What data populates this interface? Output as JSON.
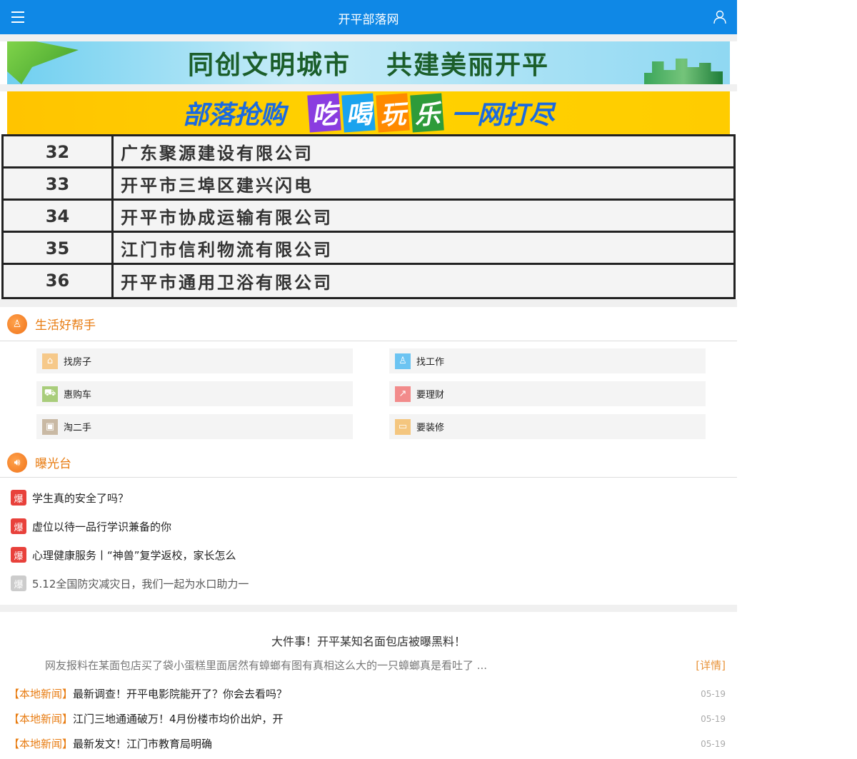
{
  "header": {
    "title": "开平部落网",
    "menu_icon": "menu-icon",
    "user_icon": "user-icon"
  },
  "banners": [
    {
      "text_a": "同创文明城市",
      "text_b": "共建美丽开平"
    },
    {
      "text_a": "部落抢购",
      "tags": [
        "吃",
        "喝",
        "玩",
        "乐"
      ],
      "text_b": "一网打尽"
    }
  ],
  "notice_table": [
    {
      "no": "32",
      "name": "广东聚源建设有限公司"
    },
    {
      "no": "33",
      "name": "开平市三埠区建兴闪电"
    },
    {
      "no": "34",
      "name": "开平市协成运输有限公司"
    },
    {
      "no": "35",
      "name": "江门市信利物流有限公司"
    },
    {
      "no": "36",
      "name": "开平市通用卫浴有限公司"
    }
  ],
  "helper": {
    "title": "生活好帮手",
    "items": [
      {
        "label": "找房子",
        "color": "#f6c98a",
        "icon": "⌂"
      },
      {
        "label": "找工作",
        "color": "#6cc4f2",
        "icon": "♙"
      },
      {
        "label": "惠购车",
        "color": "#a9cd7b",
        "icon": "⛟"
      },
      {
        "label": "要理财",
        "color": "#f28b8b",
        "icon": "↗"
      },
      {
        "label": "淘二手",
        "color": "#c9b9a4",
        "icon": "▣"
      },
      {
        "label": "要装修",
        "color": "#f4c67f",
        "icon": "▭"
      }
    ]
  },
  "exposure": {
    "title": "曝光台",
    "badge": "爆",
    "items": [
      {
        "text": "学生真的安全了吗？"
      },
      {
        "text": "虚位以待一品行学识兼备的你"
      },
      {
        "text": "心理健康服务丨“神兽”复学返校，家长怎么"
      },
      {
        "text": "5.12全国防灾减灾日，我们一起为水口助力一"
      }
    ]
  },
  "feature": {
    "headline": "大件事！开平某知名面包店被曝黑料！",
    "summary": "网友报料在某面包店买了袋小蛋糕里面居然有蟑螂有图有真相这么大的一只蟑螂真是看吐了 ...",
    "more": "[详情]"
  },
  "news": [
    {
      "cat": "【本地新闻】",
      "title": "最新调查！开平电影院能开了？你会去看吗？",
      "date": "05-19"
    },
    {
      "cat": "【本地新闻】",
      "title": "江门三地通通破万！4月份楼市均价出炉，开",
      "date": "05-19"
    },
    {
      "cat": "【本地新闻】",
      "title": "最新发文！江门市教育局明确",
      "date": "05-19"
    }
  ]
}
